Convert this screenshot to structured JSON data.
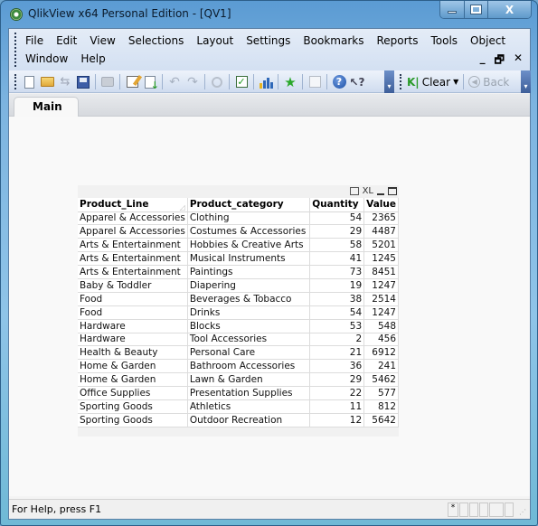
{
  "window": {
    "title": "QlikView x64 Personal Edition - [QV1]",
    "controls": {
      "minimize": "minimize",
      "maximize": "maximize",
      "close": "X"
    }
  },
  "menubar": {
    "row1": [
      "File",
      "Edit",
      "View",
      "Selections",
      "Layout",
      "Settings",
      "Bookmarks",
      "Reports",
      "Tools",
      "Object"
    ],
    "row2": [
      "Window",
      "Help"
    ],
    "mdi_controls": {
      "minimize": "_",
      "restore": "🗗",
      "close": "✕"
    }
  },
  "toolbar": {
    "icons": [
      "new-document",
      "open-folder",
      "reload",
      "save",
      "print",
      "edit-script",
      "reload-data",
      "undo",
      "redo",
      "search",
      "select-fields",
      "chart-wizard",
      "add-bookmark",
      "edit-module",
      "help",
      "context-help"
    ],
    "clear_label": "Clear",
    "back_label": "Back"
  },
  "tabs": [
    {
      "label": "Main",
      "active": true
    }
  ],
  "table_box": {
    "caption_icons": {
      "print": "print",
      "xl": "XL",
      "minimize": "minimize",
      "maximize": "maximize"
    },
    "columns": [
      "Product_Line",
      "Product_category",
      "Quantity",
      "Value"
    ],
    "rows": [
      [
        "Apparel & Accessories",
        "Clothing",
        "54",
        "2365"
      ],
      [
        "Apparel & Accessories",
        "Costumes & Accessories",
        "29",
        "4487"
      ],
      [
        "Arts & Entertainment",
        "Hobbies & Creative Arts",
        "58",
        "5201"
      ],
      [
        "Arts & Entertainment",
        "Musical Instruments",
        "41",
        "1245"
      ],
      [
        "Arts & Entertainment",
        "Paintings",
        "73",
        "8451"
      ],
      [
        "Baby & Toddler",
        "Diapering",
        "19",
        "1247"
      ],
      [
        "Food",
        "Beverages & Tobacco",
        "38",
        "2514"
      ],
      [
        "Food",
        "Drinks",
        "54",
        "1247"
      ],
      [
        "Hardware",
        "Blocks",
        "53",
        "548"
      ],
      [
        "Hardware",
        "Tool Accessories",
        "2",
        "456"
      ],
      [
        "Health & Beauty",
        "Personal Care",
        "21",
        "6912"
      ],
      [
        "Home & Garden",
        "Bathroom Accessories",
        "36",
        "241"
      ],
      [
        "Home & Garden",
        "Lawn & Garden",
        "29",
        "5462"
      ],
      [
        "Office Supplies",
        "Presentation Supplies",
        "22",
        "577"
      ],
      [
        "Sporting Goods",
        "Athletics",
        "11",
        "812"
      ],
      [
        "Sporting Goods",
        "Outdoor Recreation",
        "12",
        "5642"
      ]
    ]
  },
  "statusbar": {
    "help_text": "For Help, press F1",
    "panels": [
      "*",
      "",
      "",
      "",
      "",
      ""
    ]
  }
}
